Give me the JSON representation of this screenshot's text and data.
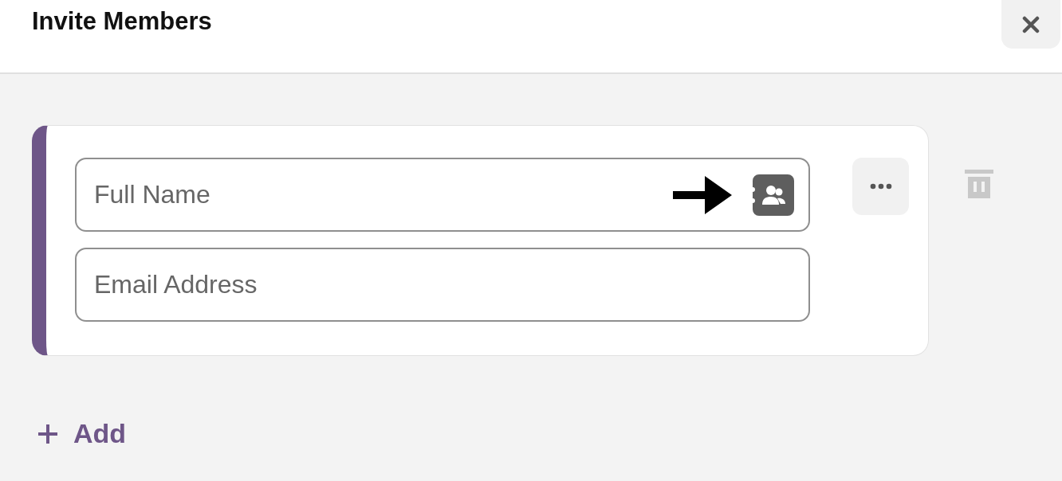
{
  "title": "Invite Members",
  "members": [
    {
      "name_placeholder": "Full Name",
      "email_placeholder": "Email Address"
    }
  ],
  "add_label": "Add"
}
